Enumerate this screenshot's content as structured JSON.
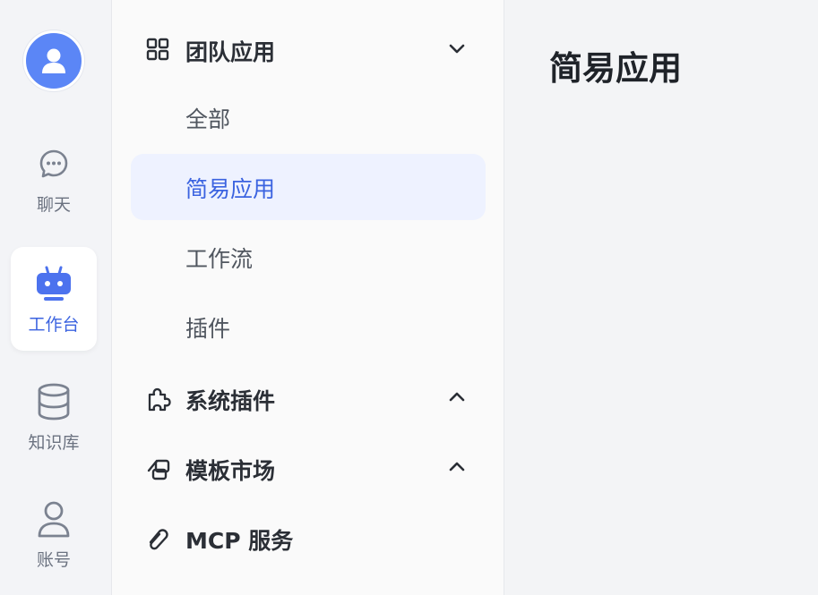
{
  "rail": {
    "items": [
      {
        "label": "聊天",
        "icon": "chat-icon"
      },
      {
        "label": "工作台",
        "icon": "robot-icon"
      },
      {
        "label": "知识库",
        "icon": "database-icon"
      },
      {
        "label": "账号",
        "icon": "user-icon"
      }
    ]
  },
  "menu": {
    "team_apps": {
      "label": "团队应用",
      "icon": "grid-icon",
      "children": [
        "全部",
        "简易应用",
        "工作流",
        "插件"
      ]
    },
    "system_plugins": {
      "label": "系统插件",
      "icon": "puzzle-icon"
    },
    "template_market": {
      "label": "模板市场",
      "icon": "template-icon"
    },
    "mcp_service": {
      "label": "MCP 服务",
      "icon": "link-icon"
    }
  },
  "main": {
    "title": "简易应用"
  },
  "colors": {
    "accent": "#3b63e0",
    "avatar": "#5b86f6",
    "active_bg": "#eef2ff"
  }
}
